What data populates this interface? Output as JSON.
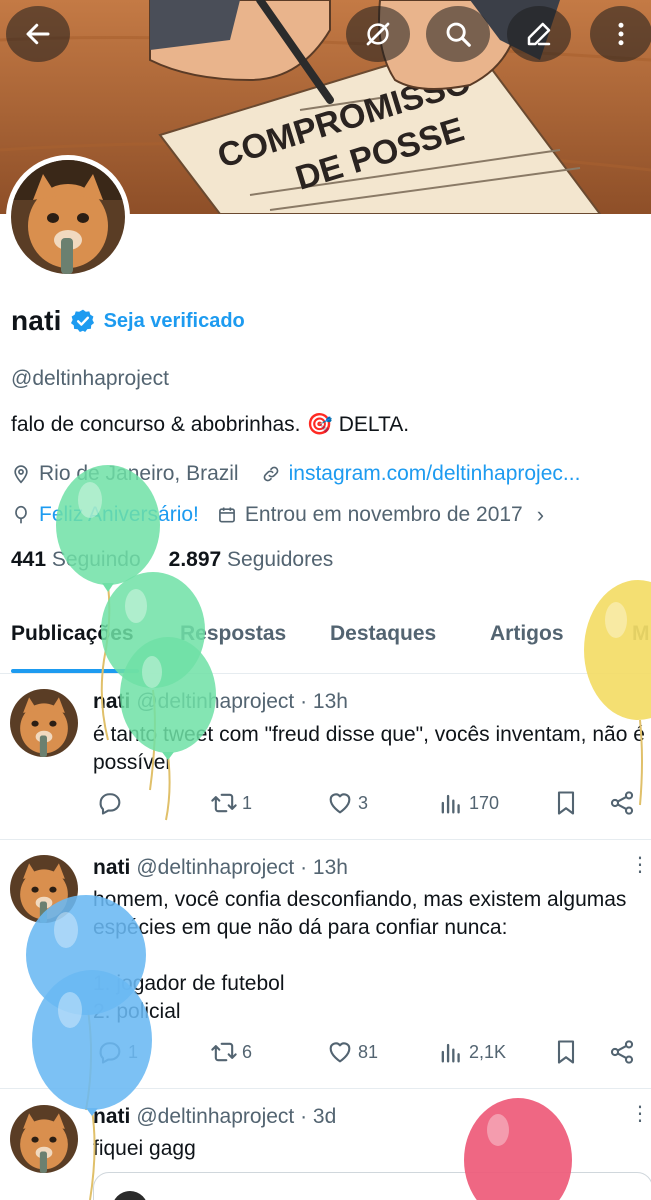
{
  "header": {
    "banner_text_line1": "COMPROMISSO",
    "banner_text_line2": "DE POSSE",
    "buttons": [
      "back-icon",
      "grok-icon",
      "search-icon",
      "edit-icon",
      "more-icon"
    ]
  },
  "profile": {
    "name": "nati",
    "verify_link": "Seja verificado",
    "handle": "@deltinhaproject",
    "bio": "falo de concurso & abobrinhas.",
    "bio_emoji": "🎯",
    "bio_end": "DELTA.",
    "location": "Rio de Janeiro, Brazil",
    "website": "instagram.com/deltinhaprojec...",
    "birthday": "Feliz Aniversário!",
    "joined": "Entrou em novembro de 2017",
    "following_count": "441",
    "following_label": "Seguindo",
    "followers_count": "2.897",
    "followers_label": "Seguidores"
  },
  "tabs": [
    "Publicações",
    "Respostas",
    "Destaques",
    "Artigos",
    "M"
  ],
  "posts": [
    {
      "name": "nati",
      "handle": "@deltinhaproject",
      "time": "· 13h",
      "lines": [
        "é tanto tweet com \"freud disse que\", vocês inventam, não é",
        "possível"
      ],
      "replies": "",
      "reposts": "1",
      "likes": "3",
      "views": "170"
    },
    {
      "name": "nati",
      "handle": "@deltinhaproject",
      "time": "· 13h",
      "lines": [
        "homem, você confia desconfiando, mas existem algumas",
        "espécies em que não dá para confiar nunca:",
        "",
        "1. jogador de futebol",
        "2. policial"
      ],
      "replies": "1",
      "reposts": "6",
      "likes": "81",
      "views": "2,1K"
    },
    {
      "name": "nati",
      "handle": "@deltinhaproject",
      "time": "· 3d",
      "lines": [
        "fiquei gagg"
      ]
    }
  ],
  "colors": {
    "accent": "#1d9bf0",
    "balloon_green": "#6fe0a6",
    "balloon_blue": "#6ab8f2",
    "balloon_yellow": "#f3dc63",
    "balloon_pink": "#ee5a78"
  }
}
